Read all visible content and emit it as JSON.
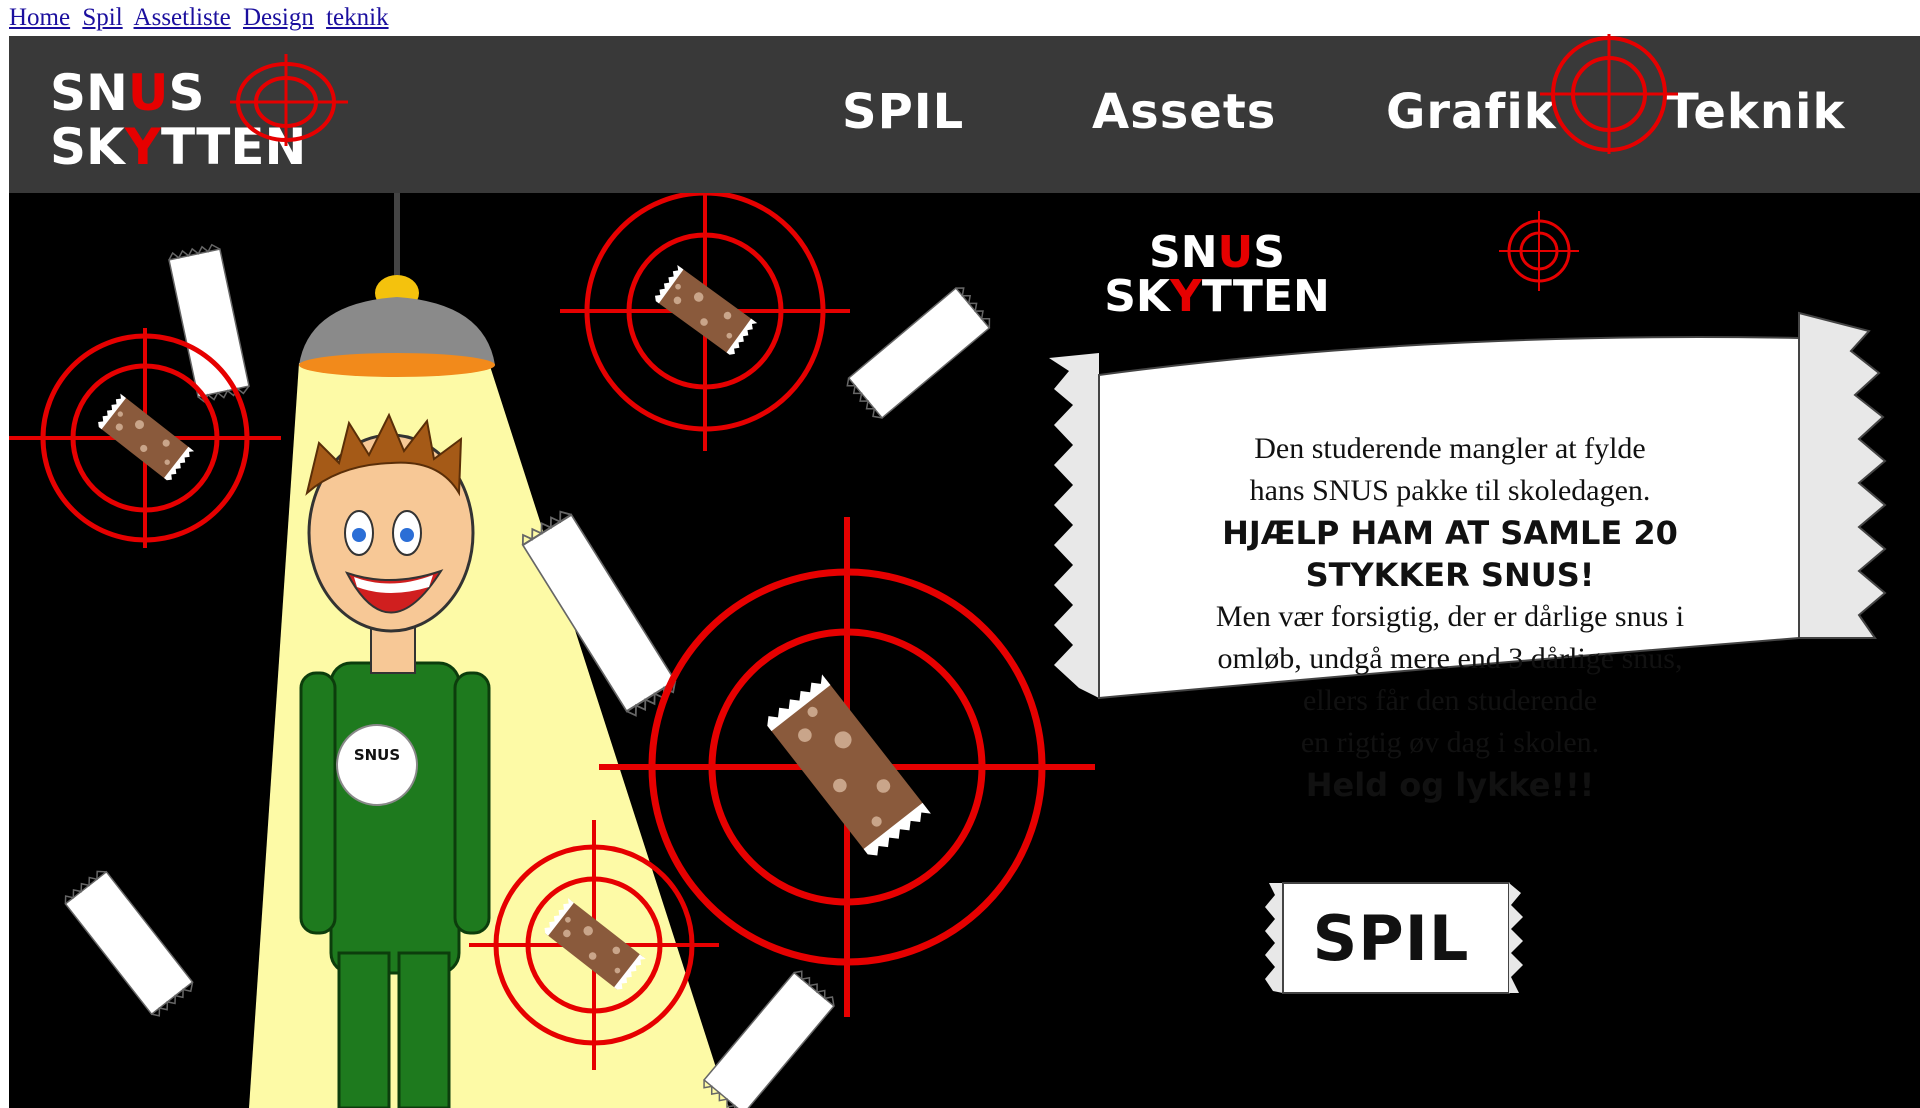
{
  "top_links": [
    "Home",
    "Spil",
    "Assetliste",
    "Design",
    "teknik"
  ],
  "logo": {
    "line1_pre": "SN",
    "line1_red": "U",
    "line1_post": "S",
    "line2_pre": "SK",
    "line2_red": "Y",
    "line2_post": "TTEN"
  },
  "nav": {
    "spil": "SPIL",
    "assets": "Assets",
    "grafik": "Grafik",
    "teknik": "Teknik"
  },
  "intro": {
    "line1": "Den studerende mangler at fylde",
    "line2": "hans SNUS pakke til skoledagen.",
    "bold1": "HJÆLP HAM AT SAMLE 20",
    "bold2": "STYKKER SNUS!",
    "line3": "Men vær forsigtig, der er dårlige snus i",
    "line4": "omløb, undgå mere end 3 dårlige snus,",
    "line5": "ellers får den studerende",
    "line6": "en rigtig øv dag i skolen.",
    "bold3": "Held og lykke!!!"
  },
  "shirt_logo": "SNUS",
  "play_label": "SPIL",
  "colors": {
    "header_bg": "#393939",
    "accent_red": "#e60000",
    "stage_bg": "#000000",
    "light_cone": "#fdfaa6",
    "shirt_green": "#1e7a1e"
  }
}
